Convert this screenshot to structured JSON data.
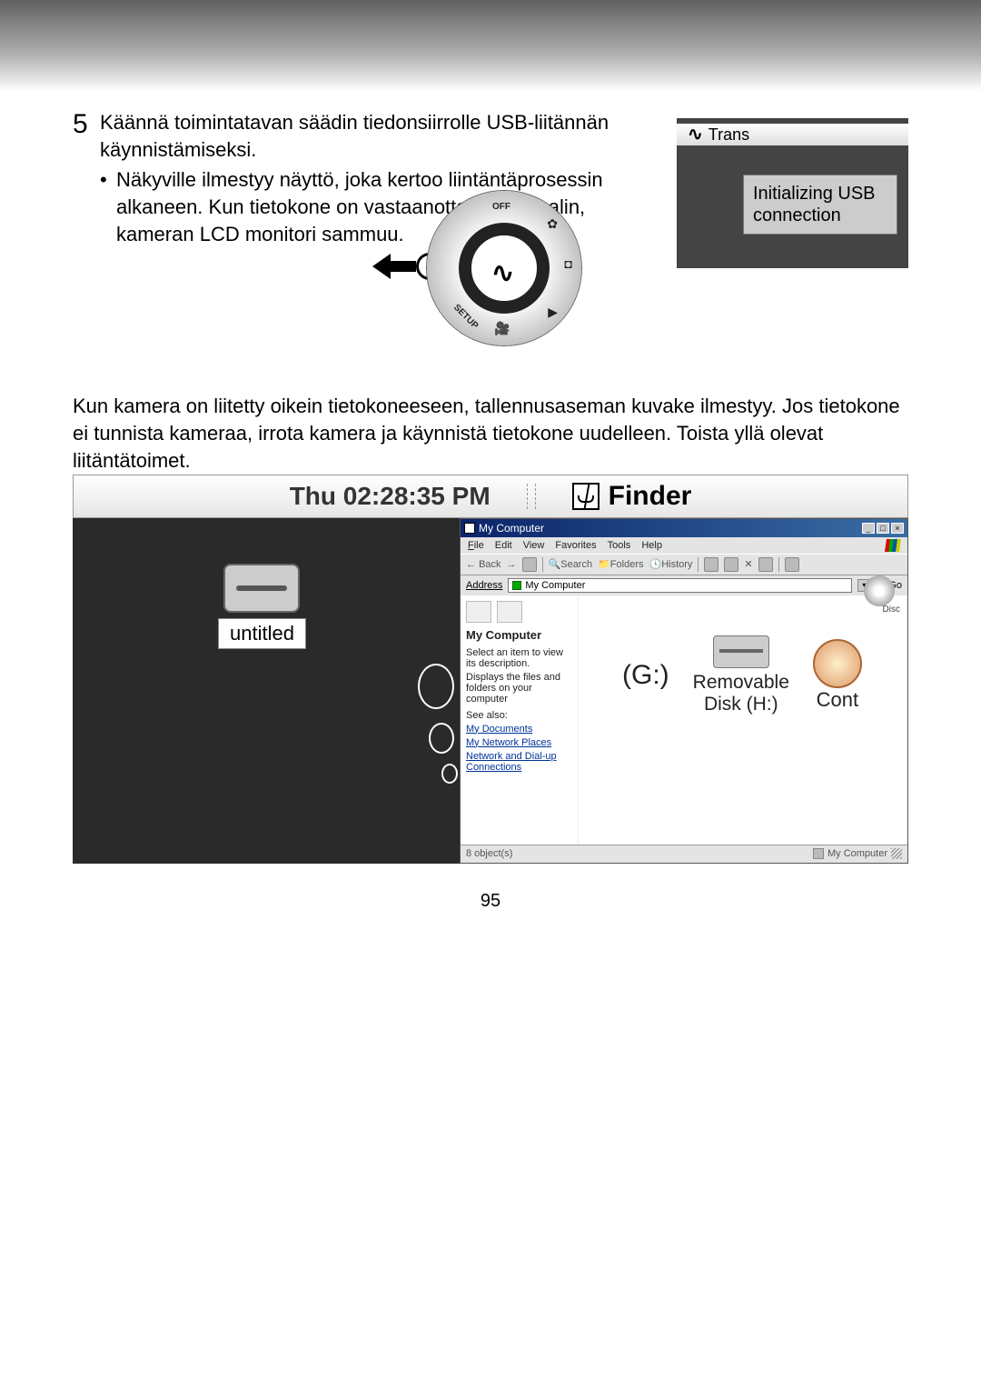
{
  "step": {
    "number": "5",
    "title_line": "Käännä toimintatavan säädin tiedonsiirrolle USB-liitännän käynnistämiseksi.",
    "bullet": "Näkyville ilmestyy näyttö, joka kertoo liintäntäprosessin alkaneen. Kun tietokone on vastaanottanut signaalin, kameran LCD monitori sammuu."
  },
  "lcd": {
    "mode_label": "Trans",
    "message": "Initializing USB connection"
  },
  "dial": {
    "off": "OFF",
    "setup": "SETUP"
  },
  "paragraph2": "Kun kamera on liitetty oikein tietokoneeseen, tallennusaseman kuvake ilmestyy. Jos tietokone ei tunnista kameraa, irrota kamera ja käynnistä tietokone uudelleen. Toista yllä olevat liitäntätoimet.",
  "mac": {
    "time": "Thu 02:28:35 PM",
    "finder": "Finder",
    "disk_label": "untitled"
  },
  "win": {
    "title": "My Computer",
    "menu": {
      "file": "File",
      "edit": "Edit",
      "view": "View",
      "favorites": "Favorites",
      "tools": "Tools",
      "help": "Help"
    },
    "toolbar": {
      "back": "Back",
      "search": "Search",
      "folders": "Folders",
      "history": "History"
    },
    "address_label": "Address",
    "address_value": "My Computer",
    "go": "Go",
    "sidebar": {
      "title": "My Computer",
      "select": "Select an item to view its description.",
      "displays": "Displays the files and folders on your computer",
      "see_also": "See also:",
      "my_documents": "My Documents",
      "my_network": "My Network Places",
      "dialup": "Network and Dial-up Connections"
    },
    "overlay": {
      "g": "(G:)",
      "removable": "Removable",
      "diskh": "Disk (H:)",
      "cont": "Cont"
    },
    "top_disc": "Disc",
    "status_objects": "8 object(s)",
    "status_right": "My Computer"
  },
  "page_number": "95"
}
